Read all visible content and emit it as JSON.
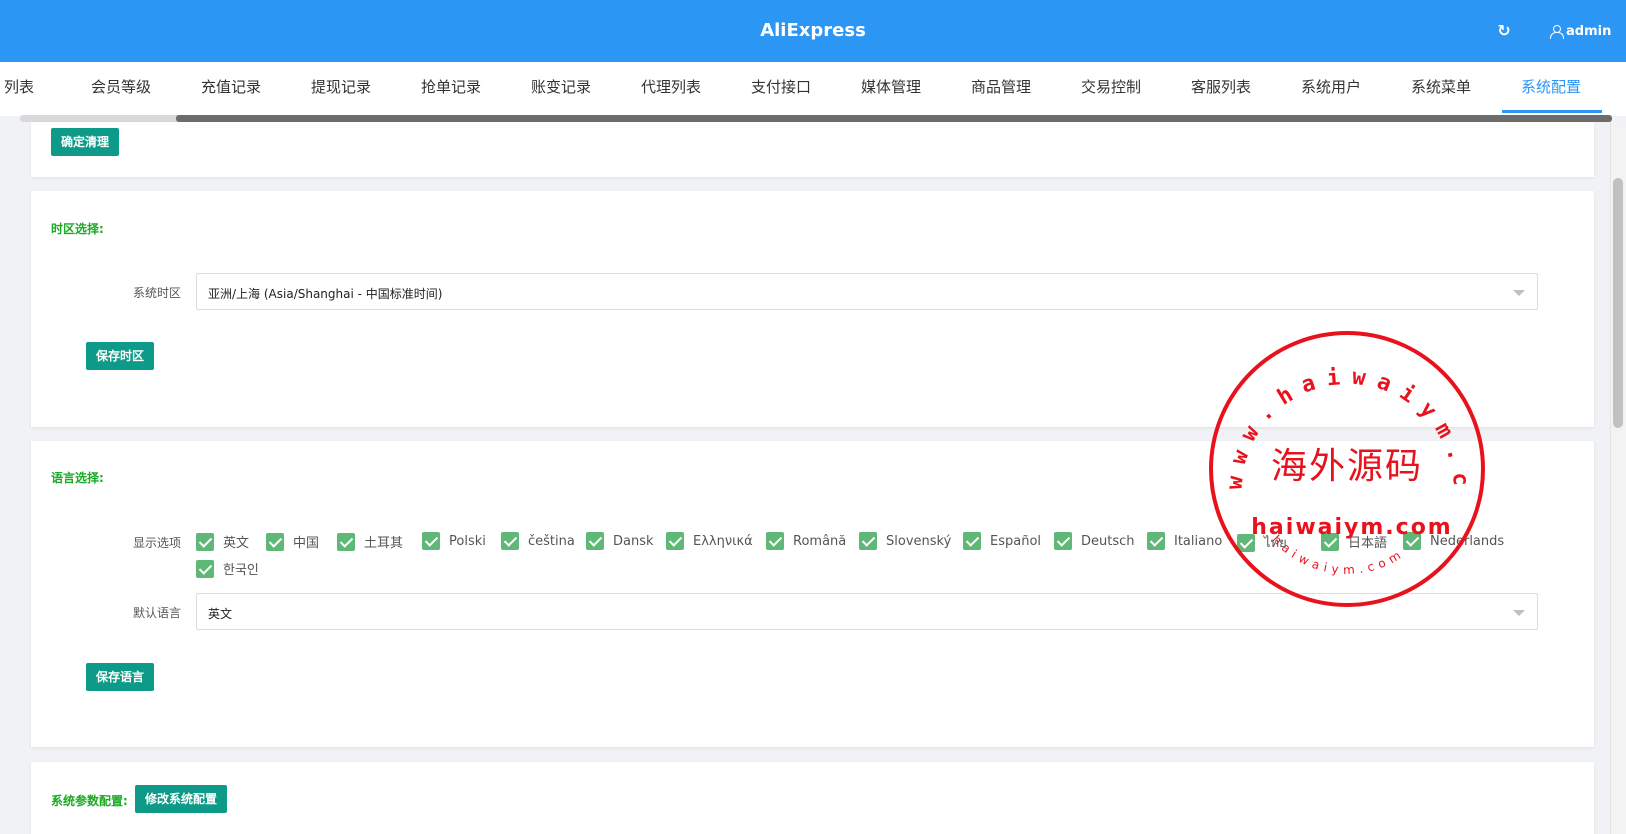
{
  "header": {
    "title": "AliExpress",
    "refresh_icon": "refresh-icon",
    "user_icon": "user-icon",
    "user_label": "admin"
  },
  "tabs": [
    {
      "label": "列表"
    },
    {
      "label": "会员等级"
    },
    {
      "label": "充值记录"
    },
    {
      "label": "提现记录"
    },
    {
      "label": "抢单记录"
    },
    {
      "label": "账变记录"
    },
    {
      "label": "代理列表"
    },
    {
      "label": "支付接口"
    },
    {
      "label": "媒体管理"
    },
    {
      "label": "商品管理"
    },
    {
      "label": "交易控制"
    },
    {
      "label": "客服列表"
    },
    {
      "label": "系统用户"
    },
    {
      "label": "系统菜单"
    },
    {
      "label": "系统配置",
      "active": true
    }
  ],
  "clear_card": {
    "confirm_button": "确定清理"
  },
  "timezone_card": {
    "title": "时区选择:",
    "label": "系统时区",
    "value": "亚洲/上海 (Asia/Shanghai - 中国标准时间)",
    "save_button": "保存时区"
  },
  "language_card": {
    "title": "语言选择:",
    "display_label": "显示选项",
    "options": [
      "英文",
      "中国",
      "土耳其",
      "Polski",
      "čeština",
      "Dansk",
      "Ελληνικά",
      "Română",
      "Slovenský",
      "Español",
      "Deutsch",
      "Italiano",
      "ไทย",
      "日本語",
      "Nederlands",
      "한국인"
    ],
    "default_label": "默认语言",
    "default_value": "英文",
    "save_button": "保存语言"
  },
  "system_card": {
    "title": "系统参数配置:",
    "edit_button": "修改系统配置"
  },
  "watermark": {
    "ring_text": "www.haiwaiym.com",
    "center_text": "海外源码",
    "lower_text": "haiwaiym.com",
    "bottom_text": "haiwaiym.com"
  },
  "colors": {
    "header_bg": "#2c96f5",
    "button": "#0e9a88",
    "section_title": "#1aaa23",
    "checkbox": "#5fb878",
    "stamp": "#e8121c"
  }
}
